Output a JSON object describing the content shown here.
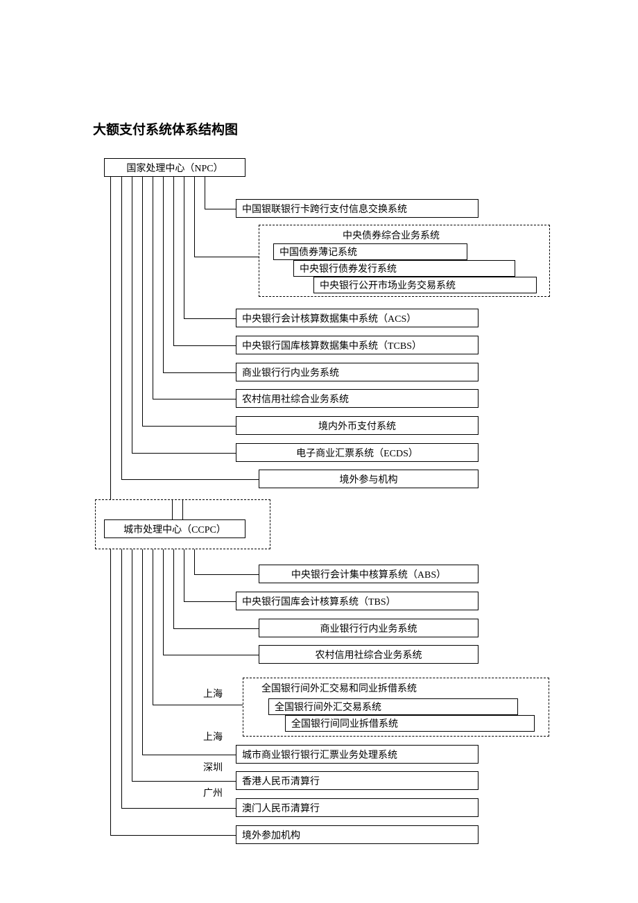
{
  "title": "大额支付系统体系结构图",
  "npc": {
    "label": "国家处理中心（NPC）",
    "children": [
      {
        "label": "中国银联银行卡跨行支付信息交换系统"
      },
      {
        "group_label": "中央债券综合业务系统",
        "items": [
          "中国债券薄记系统",
          "中央银行债券发行系统",
          "中央银行公开市场业务交易系统"
        ]
      },
      {
        "label": "中央银行会计核算数据集中系统（ACS）"
      },
      {
        "label": "中央银行国库核算数据集中系统（TCBS）"
      },
      {
        "label": "商业银行行内业务系统"
      },
      {
        "label": "农村信用社综合业务系统"
      },
      {
        "label": "境内外币支付系统"
      },
      {
        "label": "电子商业汇票系统（ECDS）"
      },
      {
        "label": "境外参与机构"
      }
    ]
  },
  "ccpc": {
    "label": "城市处理中心（CCPC）",
    "children": [
      {
        "label": "中央银行会计集中核算系统（ABS）"
      },
      {
        "label": "中央银行国库会计核算系统（TBS）"
      },
      {
        "label": "商业银行行内业务系统"
      },
      {
        "label": "农村信用社综合业务系统"
      },
      {
        "city": "上海",
        "group_label": "全国银行间外汇交易和同业拆借系统",
        "items": [
          "全国银行间外汇交易系统",
          "全国银行间同业拆借系统"
        ]
      },
      {
        "city": "上海",
        "label": "城市商业银行银行汇票业务处理系统"
      },
      {
        "city": "深圳",
        "label": "香港人民币清算行"
      },
      {
        "city": "广州",
        "label": "澳门人民币清算行"
      },
      {
        "label": "境外参加机构"
      }
    ]
  }
}
